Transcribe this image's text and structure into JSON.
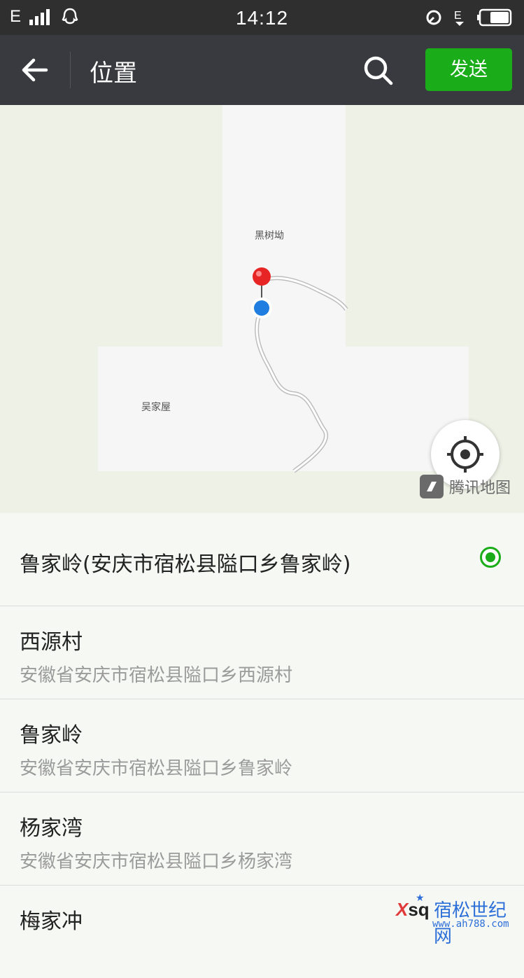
{
  "status_bar": {
    "network": "E",
    "time": "14:12"
  },
  "topbar": {
    "title": "位置",
    "send_label": "发送"
  },
  "map": {
    "labels": [
      "黑树坳",
      "吴家屋"
    ],
    "provider": "腾讯地图"
  },
  "selected_location": "鲁家岭(安庆市宿松县隘口乡鲁家岭)",
  "locations": [
    {
      "name": "西源村",
      "address": "安徽省安庆市宿松县隘口乡西源村"
    },
    {
      "name": "鲁家岭",
      "address": "安徽省安庆市宿松县隘口乡鲁家岭"
    },
    {
      "name": "杨家湾",
      "address": "安徽省安庆市宿松县隘口乡杨家湾"
    },
    {
      "name": "梅家冲",
      "address": ""
    }
  ],
  "watermark": {
    "logo": "xsq",
    "title": "宿松世纪网",
    "url": "www.ah788.com"
  },
  "colors": {
    "accent": "#1aad19",
    "topbar": "#393a3f",
    "statusbar": "#2f2f2f",
    "pin_red": "#e82525",
    "pin_blue": "#1f7ee0"
  }
}
